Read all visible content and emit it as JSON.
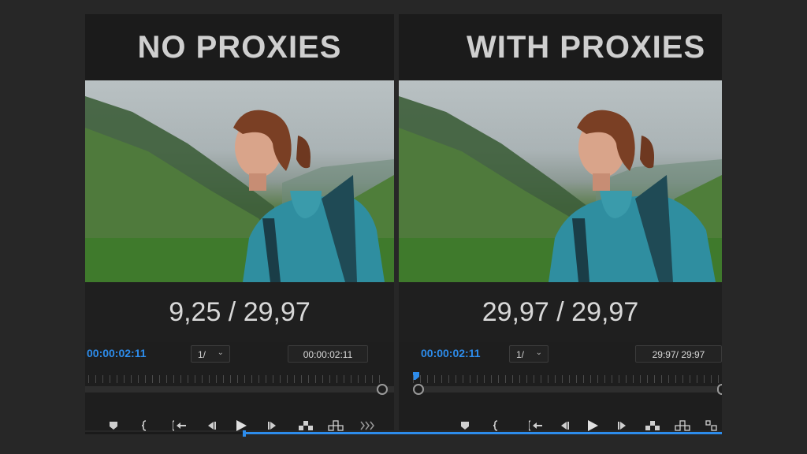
{
  "left": {
    "title": "NO PROXIES",
    "fps": "9,25 / 29,97",
    "timecode": "00:00:02:11",
    "zoom": "1/",
    "duration": "00:00:02:11"
  },
  "right": {
    "title": "WITH PROXIES",
    "fps": "29,97 / 29,97",
    "timecode": "00:00:02:11",
    "zoom": "1/",
    "duration": "29:97/ 29:97"
  },
  "colors": {
    "accent": "#2d8ceb",
    "panel_bg": "#1d1d1d",
    "page_bg": "#272727"
  },
  "icons": {
    "chevron": "⌄"
  }
}
